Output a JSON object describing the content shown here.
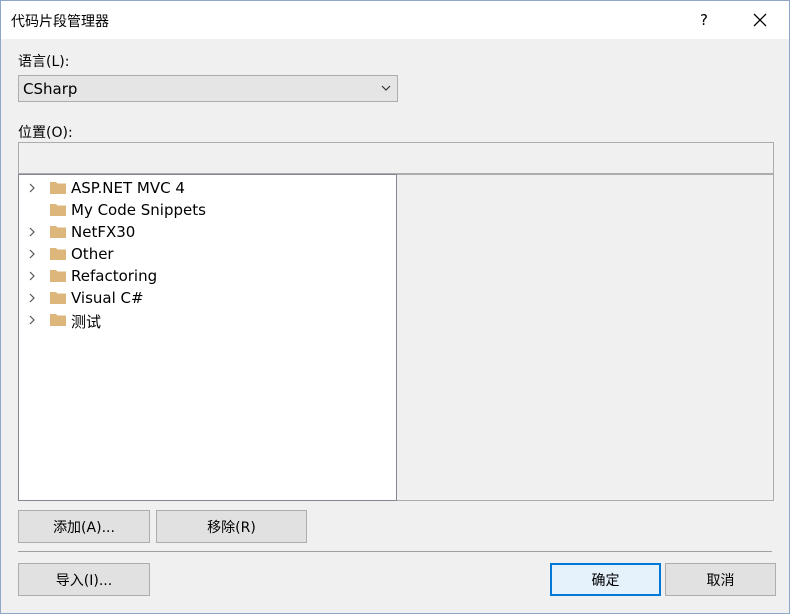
{
  "window": {
    "title": "代码片段管理器",
    "help_label": "?",
    "close_label": "✕"
  },
  "language": {
    "label": "语言(L):",
    "selected": "CSharp"
  },
  "location": {
    "label": "位置(O):",
    "value": ""
  },
  "tree": {
    "items": [
      {
        "label": "ASP.NET MVC 4",
        "expandable": true
      },
      {
        "label": "My Code Snippets",
        "expandable": false
      },
      {
        "label": "NetFX30",
        "expandable": true
      },
      {
        "label": "Other",
        "expandable": true
      },
      {
        "label": "Refactoring",
        "expandable": true
      },
      {
        "label": "Visual C#",
        "expandable": true
      },
      {
        "label": "测试",
        "expandable": true
      }
    ]
  },
  "buttons": {
    "add": "添加(A)...",
    "remove": "移除(R)",
    "import": "导入(I)...",
    "ok": "确定",
    "cancel": "取消"
  },
  "colors": {
    "folder": "#dcb67a",
    "accent": "#0078d7"
  }
}
